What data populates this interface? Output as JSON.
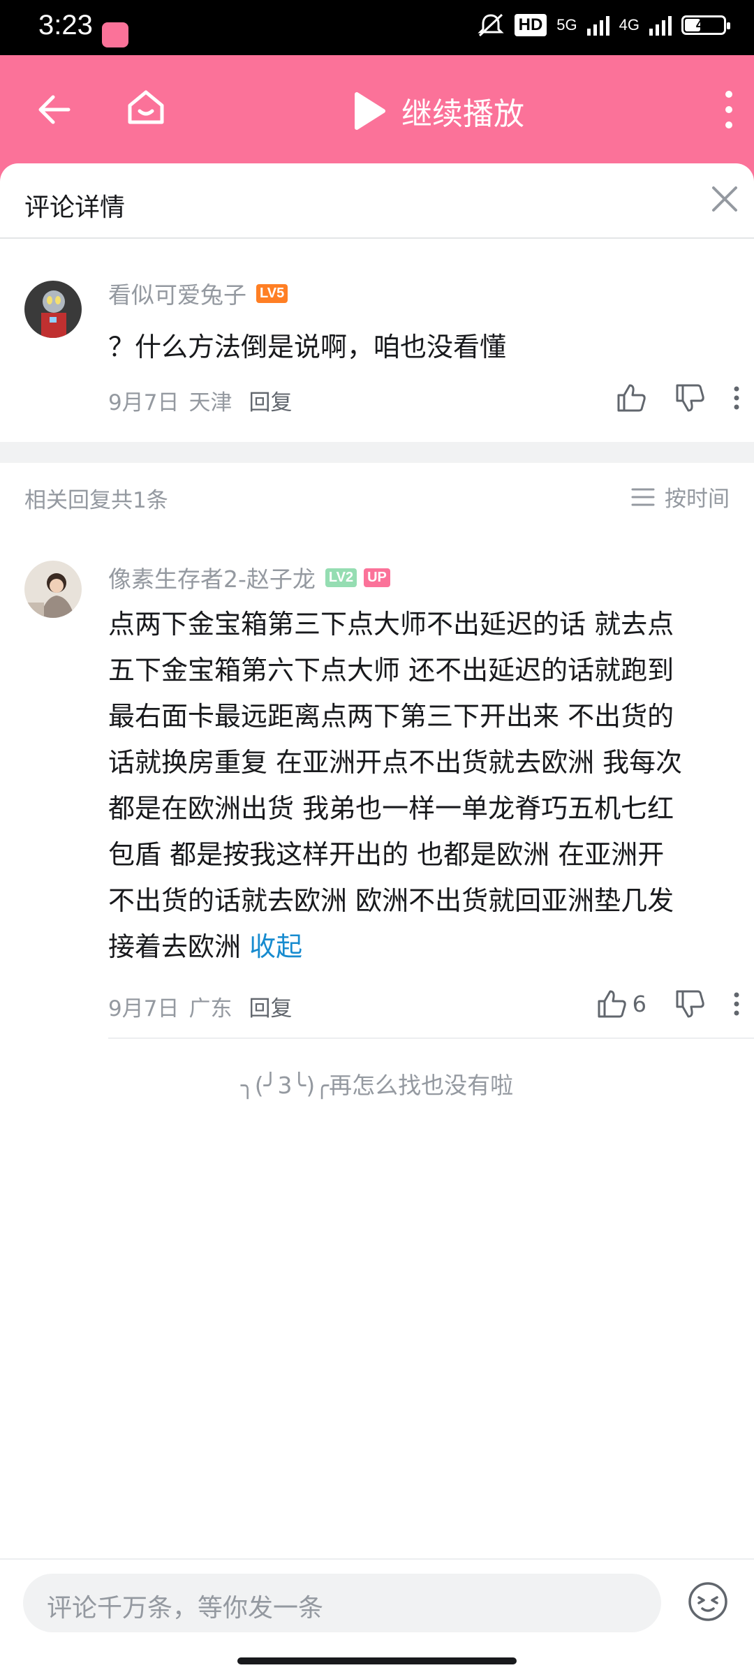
{
  "status": {
    "time": "3:23",
    "hd": "HD",
    "net1": "5G",
    "net2": "4G",
    "battery": "41"
  },
  "topbar": {
    "play_label": "继续播放"
  },
  "detail": {
    "title": "评论详情"
  },
  "root_comment": {
    "username": "看似可爱兔子",
    "level": "LV5",
    "level_color": "#ff7f24",
    "text": "？什么方法倒是说啊，咱也没看懂",
    "date": "9月7日",
    "location": "天津",
    "reply_label": "回复"
  },
  "related": {
    "count_label": "相关回复共1条",
    "sort_label": "按时间"
  },
  "reply_comment": {
    "username": "像素生存者2-赵子龙",
    "level": "LV2",
    "level_color": "#95ddb2",
    "up_badge": "UP",
    "up_color": "#fb7299",
    "lines": [
      "点两下金宝箱第三下点大师不出延迟的话 就去点",
      "五下金宝箱第六下点大师 还不出延迟的话就跑到",
      "最右面卡最远距离点两下第三下开出来 不出货的",
      "话就换房重复 在亚洲开点不出货就去欧洲 我每次",
      "都是在欧洲出货 我弟也一样一单龙脊巧五机七红",
      "包盾 都是按我这样开出的 也都是欧洲 在亚洲开",
      "不出货的话就去欧洲  欧洲不出货就回亚洲垫几发",
      "接着去欧洲"
    ],
    "collapse_label": "收起",
    "date": "9月7日",
    "location": "广东",
    "reply_label": "回复",
    "likes": "6"
  },
  "footer": {
    "no_more": "╮(╯3╰)╭再怎么找也没有啦",
    "input_placeholder": "评论千万条，等你发一条"
  },
  "colors": {
    "brand_pink": "#fb7299",
    "link_blue": "#178bcf"
  }
}
